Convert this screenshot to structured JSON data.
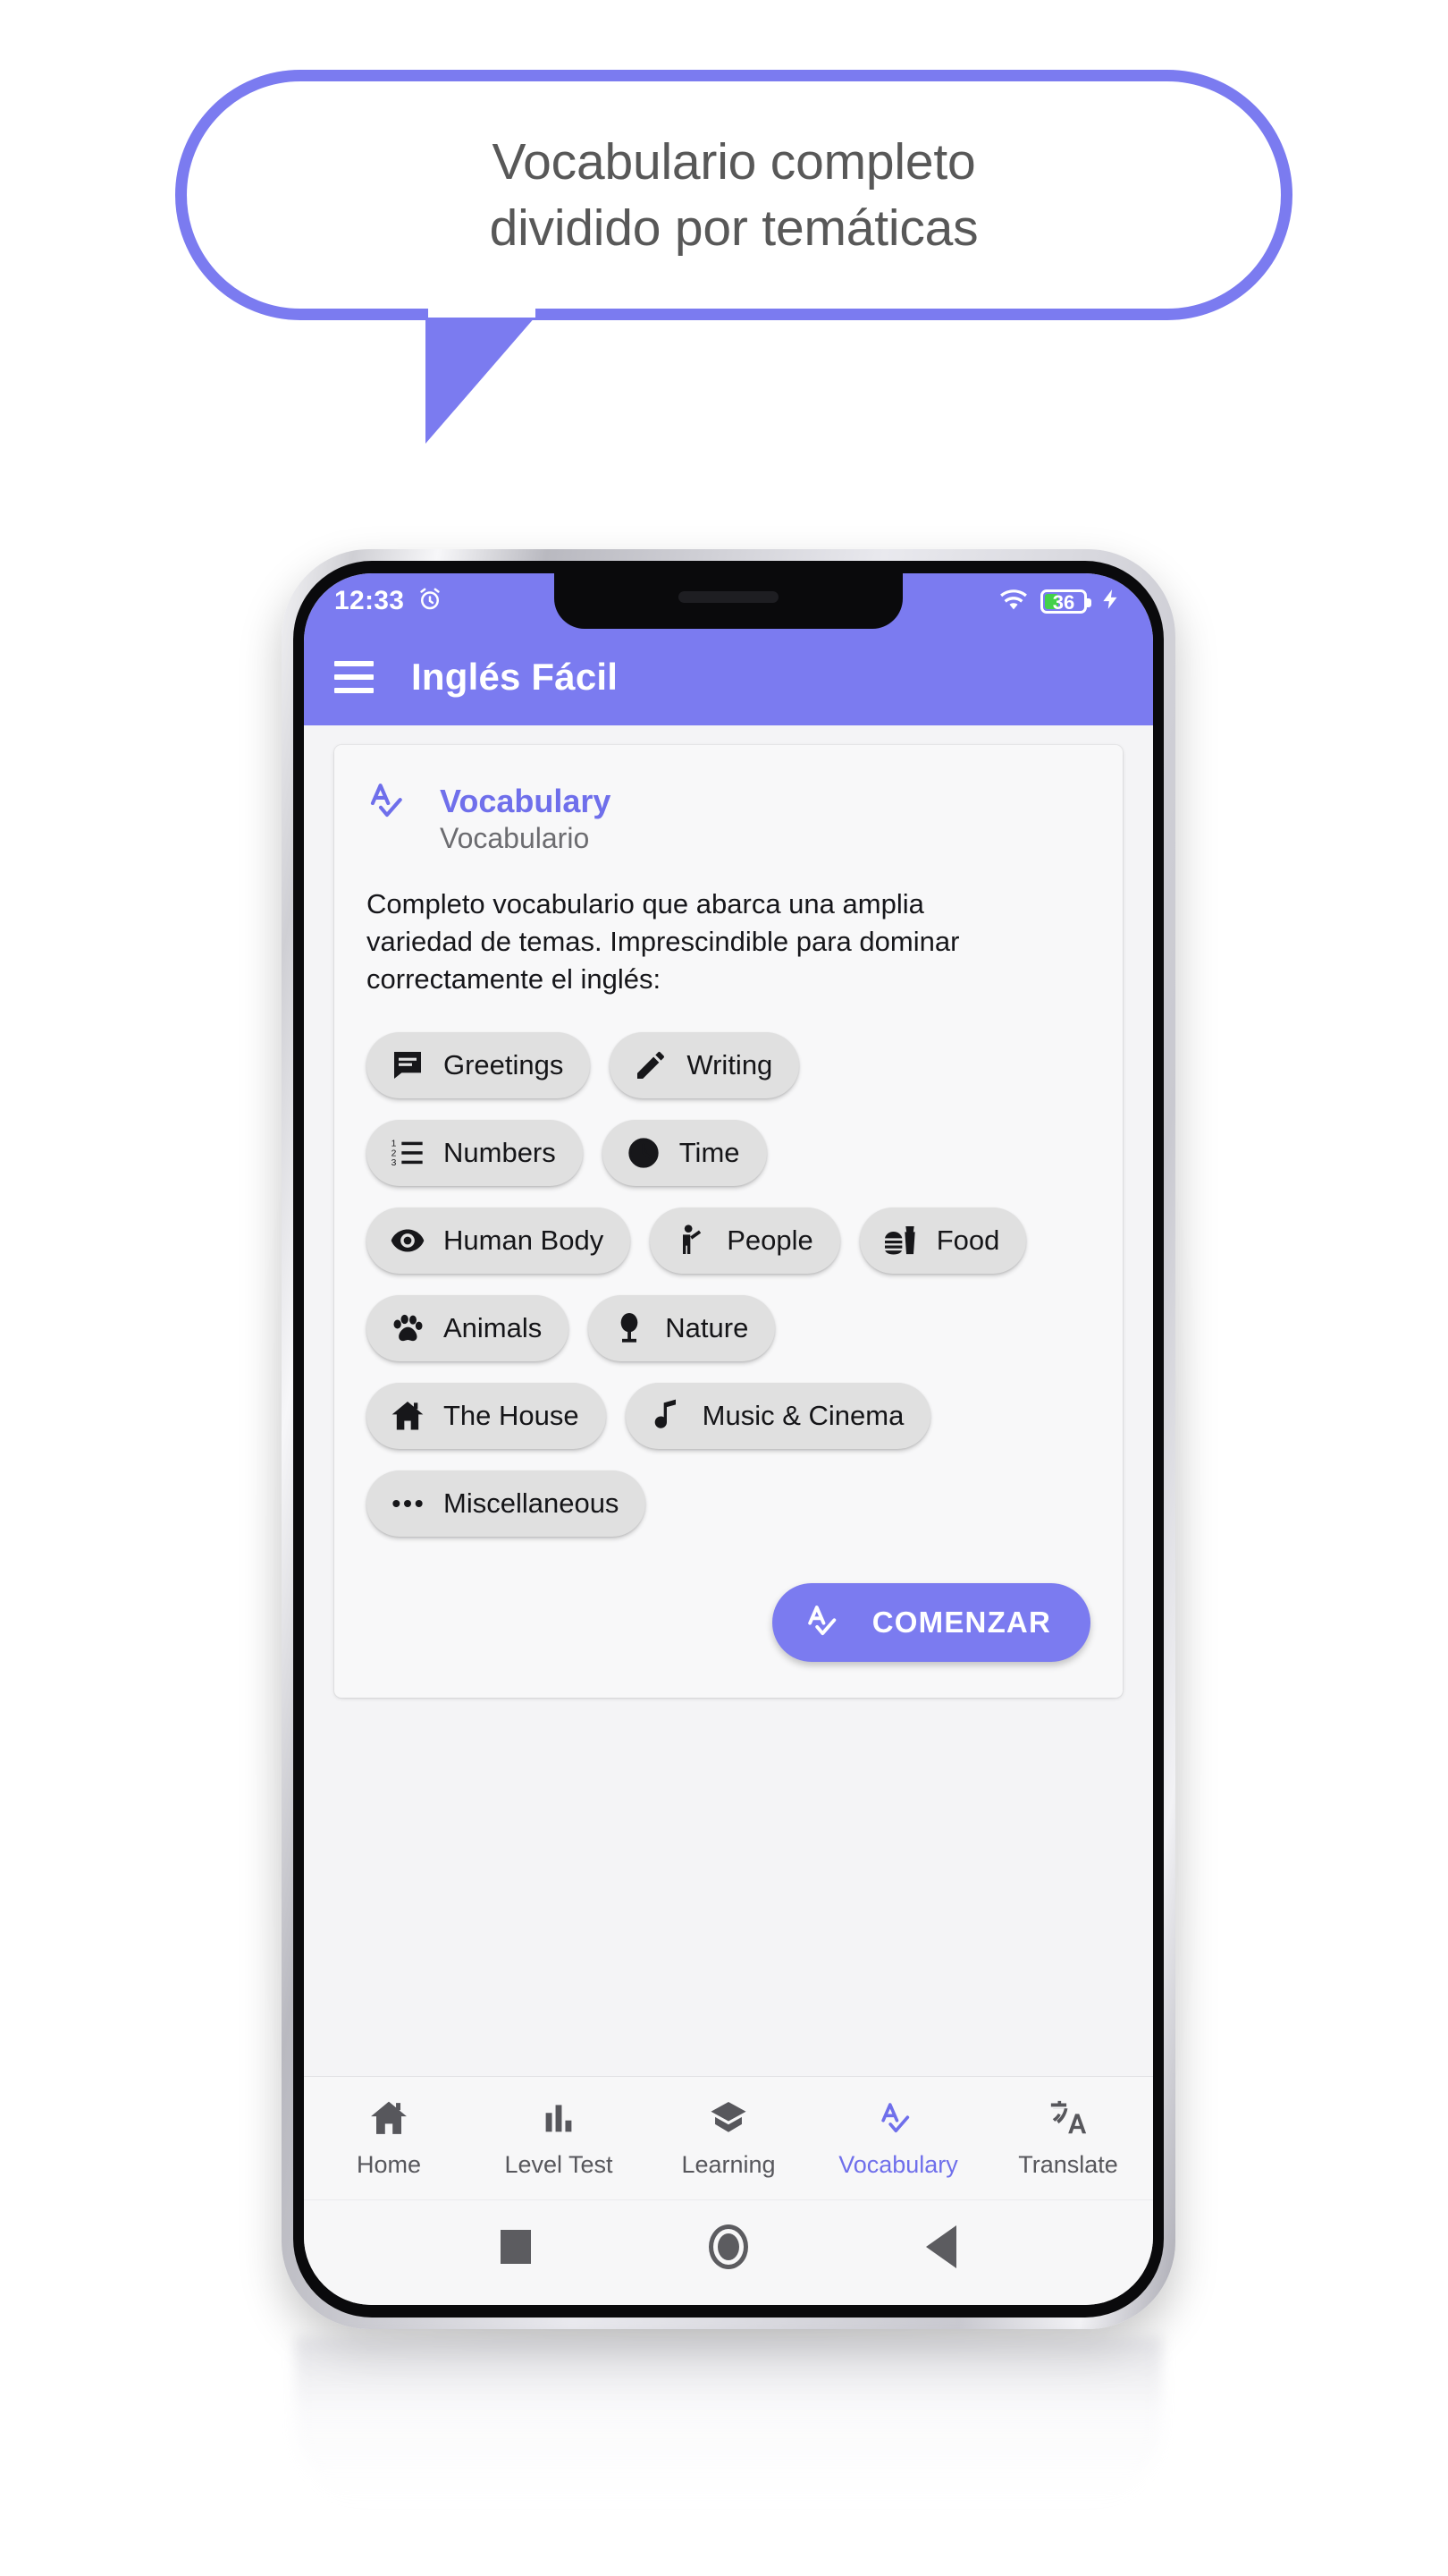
{
  "callout": {
    "text": "Vocabulario completo\ndividido por temáticas",
    "border_color": "#7b7bf0",
    "text_color": "#585858"
  },
  "phone": {
    "status_bar": {
      "time": "12:33",
      "alarm_icon": "alarm-icon",
      "wifi_icon": "wifi-icon",
      "battery_level": "36",
      "charging_icon": "charging-bolt-icon",
      "background_color": "#7b7bf0"
    },
    "app_bar": {
      "menu_icon": "hamburger-menu-icon",
      "title": "Inglés Fácil",
      "background_color": "#7b7bf0"
    },
    "card": {
      "icon": "spellcheck-icon",
      "title": "Vocabulary",
      "subtitle": "Vocabulario",
      "title_color": "#6f6feb",
      "description": "Completo vocabulario que abarca una amplia\nvariedad de temas. Imprescindible para dominar\ncorrectamente el inglés:",
      "chip_rows": [
        [
          {
            "label": "Greetings",
            "icon": "chat-bubble-icon"
          },
          {
            "label": "Writing",
            "icon": "pencil-icon"
          }
        ],
        [
          {
            "label": "Numbers",
            "icon": "numbered-list-icon"
          },
          {
            "label": "Time",
            "icon": "clock-icon"
          }
        ],
        [
          {
            "label": "Human Body",
            "icon": "eye-icon"
          },
          {
            "label": "People",
            "icon": "person-waving-icon"
          },
          {
            "label": "Food",
            "icon": "fastfood-icon"
          }
        ],
        [
          {
            "label": "Animals",
            "icon": "paw-icon"
          },
          {
            "label": "Nature",
            "icon": "park-tree-icon"
          }
        ],
        [
          {
            "label": "The House",
            "icon": "home-icon"
          },
          {
            "label": "Music & Cinema",
            "icon": "music-note-icon"
          }
        ],
        [
          {
            "label": "Miscellaneous",
            "icon": "more-horizontal-icon"
          }
        ]
      ],
      "cta": {
        "label": "COMENZAR",
        "icon": "spellcheck-icon",
        "background_color": "#7b7bf0"
      }
    },
    "bottom_nav": {
      "active_index": 3,
      "active_color": "#6f6feb",
      "items": [
        {
          "label": "Home",
          "icon": "home-icon"
        },
        {
          "label": "Level Test",
          "icon": "bar-chart-icon"
        },
        {
          "label": "Learning",
          "icon": "graduation-cap-icon"
        },
        {
          "label": "Vocabulary",
          "icon": "spellcheck-icon"
        },
        {
          "label": "Translate",
          "icon": "translate-icon"
        }
      ]
    },
    "system_nav": {
      "recents": "recents-square-button",
      "home": "home-circle-button",
      "back": "back-triangle-button"
    }
  }
}
